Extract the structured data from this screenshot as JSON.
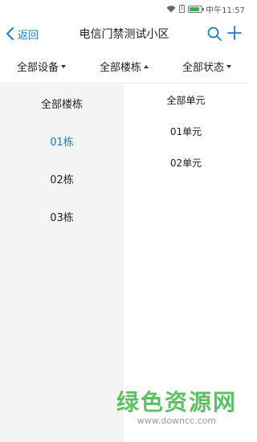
{
  "status_bar": {
    "time": "中午11:57",
    "battery_level": 0.85,
    "sim_label": "1"
  },
  "header": {
    "back_label": "返回",
    "title": "电信门禁测试小区"
  },
  "filters": [
    {
      "label": "全部设备",
      "state": "collapsed"
    },
    {
      "label": "全部楼栋",
      "state": "expanded"
    },
    {
      "label": "全部状态",
      "state": "collapsed"
    }
  ],
  "buildings": {
    "header": "全部楼栋",
    "items": [
      "01栋",
      "02栋",
      "03栋"
    ],
    "selected": "01栋"
  },
  "units": {
    "header": "全部单元",
    "items": [
      "01单元",
      "02单元"
    ]
  },
  "watermark": {
    "title": "绿色资源网",
    "url": "www.downcc.com"
  },
  "colors": {
    "accent": "#1e7cc8",
    "panel_bg": "#f4f4f4",
    "watermark_green": "#43b649"
  },
  "icons": {
    "back": "chevron-left-icon",
    "search": "search-icon",
    "add": "plus-icon",
    "wifi": "wifi-icon",
    "battery": "battery-icon"
  }
}
